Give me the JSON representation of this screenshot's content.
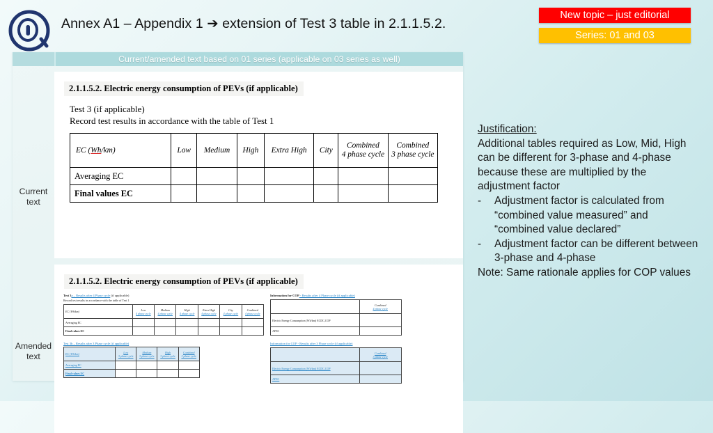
{
  "logo": {
    "icon": "at-sign-circle-logo"
  },
  "title": "Annex A1 – Appendix 1 ➔  extension of Test 3 table in 2.1.1.5.2.",
  "badges": {
    "topic": {
      "label": "New topic – just editorial",
      "color": "#FF0000"
    },
    "series": {
      "label": "Series: 01 and 03",
      "color": "#FFC000"
    }
  },
  "panel": {
    "band_title": "Current/amended text based on 01 series (applicable on 03 series as well)",
    "row_labels": {
      "current": "Current text",
      "amended": "Amended text"
    }
  },
  "current": {
    "heading": "2.1.1.5.2. Electric energy consumption of PEVs (if applicable)",
    "line1": "Test 3 (if applicable)",
    "line2": "Record test results in accordance with the table of Test 1",
    "table": {
      "lead_header": "EC (Wh/km)",
      "columns": [
        {
          "top": "Low",
          "bottom": ""
        },
        {
          "top": "Medium",
          "bottom": ""
        },
        {
          "top": "High",
          "bottom": ""
        },
        {
          "top": "Extra High",
          "bottom": ""
        },
        {
          "top": "City",
          "bottom": ""
        },
        {
          "top": "Combined",
          "bottom": "4 phase cycle"
        },
        {
          "top": "Combined",
          "bottom": "3 phase cycle"
        }
      ],
      "rows": [
        "Averaging EC",
        "Final values EC"
      ]
    }
  },
  "amended": {
    "heading": "2.1.1.5.2. Electric energy consumption of PEVs (if applicable)",
    "table_a": {
      "title_static": "Test 3",
      "title_inserted": "a – Results after 4 Phase cycle",
      "title_tail": " (if applicable)",
      "subtitle": "Record test results in accordance with the table of Test 1",
      "lead_header": "EC (Wh/km)",
      "columns": [
        {
          "top": "Low",
          "bottom": "4 phase cycle"
        },
        {
          "top": "Medium",
          "bottom": "4 phase cycle"
        },
        {
          "top": "High",
          "bottom": "4 phase cycle"
        },
        {
          "top": "Extra High",
          "bottom": "4 phase cycle"
        },
        {
          "top": "City",
          "bottom": "4 phase cycle"
        },
        {
          "top": "Combined",
          "bottom": "4 phase cycle"
        }
      ],
      "rows": [
        "Averaging EC",
        "Final values EC"
      ]
    },
    "table_b": {
      "title": "Test 3b – Results after 3 Phase cycle (if applicable)",
      "lead_header": "EC (Wh/km)",
      "columns": [
        {
          "top": "Low",
          "bottom": "3 phase cycle"
        },
        {
          "top": "Medium",
          "bottom": "3 phase cycle"
        },
        {
          "top": "High",
          "bottom": "3 phase cycle"
        },
        {
          "top": "Combined",
          "bottom": "3 phase cycle"
        }
      ],
      "rows": [
        "Averaging EC",
        "Final values EC"
      ]
    },
    "cop_a": {
      "title_static": "Information for COP",
      "title_inserted": " - Results after 4 Phase cycle (if applicable)",
      "col_top": "Combined",
      "col_bottom": "4 phase cycle",
      "rows": [
        "Electric Energy Consumption (Wh/km) ECDC,COP",
        "AFEC"
      ]
    },
    "cop_b": {
      "title": "Information for COP - Results after 3 Phase cycle (if applicable)",
      "col_top": "Combined",
      "col_bottom": "3 phase cycle",
      "rows": [
        "Electric Energy Consumption (Wh/km) ECDC,COP",
        "AFEC"
      ]
    }
  },
  "justification": {
    "title": "Justification:",
    "paragraph": "Additional tables required as Low, Mid, High can be different for 3-phase and 4-phase because these are multiplied by the adjustment factor",
    "bullets": [
      "Adjustment factor is calculated from “combined value measured” and “combined value declared”",
      "Adjustment factor can be different between 3-phase and 4-phase"
    ],
    "note": "Note: Same rationale applies for COP values"
  }
}
